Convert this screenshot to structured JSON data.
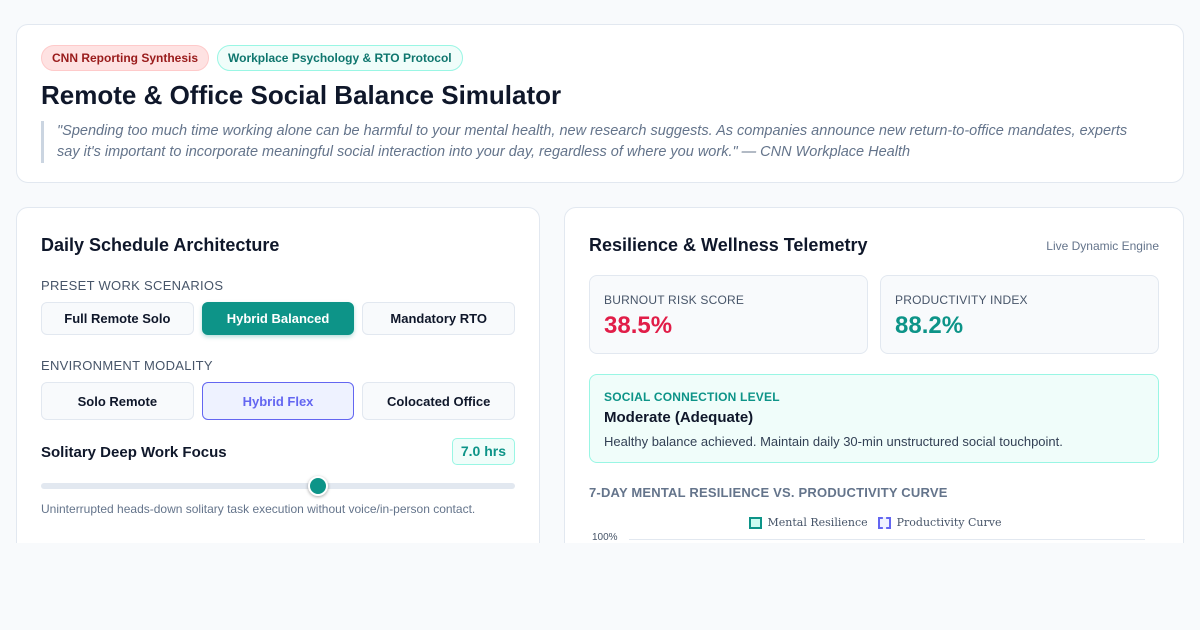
{
  "header": {
    "badges": [
      "CNN Reporting Synthesis",
      "Workplace Psychology & RTO Protocol"
    ],
    "title": "Remote & Office Social Balance Simulator",
    "quote": "\"Spending too much time working alone can be harmful to your mental health, new research suggests. As companies announce new return-to-office mandates, experts say it's important to incorporate meaningful social interaction into your day, regardless of where you work.\" — CNN Workplace Health"
  },
  "schedule": {
    "title": "Daily Schedule Architecture",
    "presets_label": "PRESET WORK SCENARIOS",
    "presets": [
      "Full Remote Solo",
      "Hybrid Balanced",
      "Mandatory RTO"
    ],
    "active_preset": "Hybrid Balanced",
    "environment_label": "ENVIRONMENT MODALITY",
    "environments": [
      "Solo Remote",
      "Hybrid Flex",
      "Colocated Office"
    ],
    "active_environment": "Hybrid Flex",
    "slider": {
      "label": "Solitary Deep Work Focus",
      "value_text": "7.0 hrs",
      "value": 7.0,
      "min": 0,
      "max": 12,
      "description": "Uninterrupted heads-down solitary task execution without voice/in-person contact."
    }
  },
  "telemetry": {
    "title": "Resilience & Wellness Telemetry",
    "engine_label": "Live Dynamic Engine",
    "burnout": {
      "label": "BURNOUT RISK SCORE",
      "value": "38.5%",
      "color": "#e11d48"
    },
    "productivity": {
      "label": "PRODUCTIVITY INDEX",
      "value": "88.2%",
      "color": "#0d9488"
    },
    "social": {
      "label": "SOCIAL CONNECTION LEVEL",
      "level": "Moderate (Adequate)",
      "description": "Healthy balance achieved. Maintain daily 30-min unstructured social touchpoint."
    },
    "chart": {
      "heading": "7-DAY MENTAL RESILIENCE VS. PRODUCTIVITY CURVE",
      "legend": [
        "Mental Resilience",
        "Productivity Curve"
      ],
      "y_tick_top": "100%"
    }
  },
  "colors": {
    "accent": "#0d9488",
    "indigo": "#6366f1",
    "danger": "#e11d48"
  }
}
